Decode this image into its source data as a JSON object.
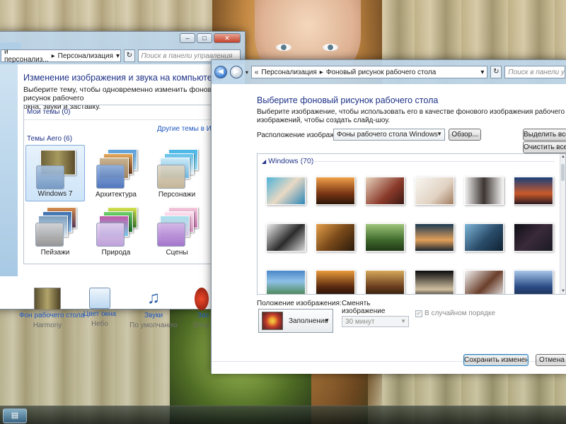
{
  "left_window": {
    "breadcrumb": [
      "и персонализ...",
      "Персонализация"
    ],
    "search_placeholder": "Поиск в панели управления",
    "title": "Изменение изображения и звука на компьютере",
    "desc_line1": "Выберите тему, чтобы одновременно изменить фоновый рисунок рабочего",
    "desc_line2": "окна, звуки и заставку.",
    "my_themes": "Мои темы (0)",
    "online_link": "Другие темы в Интер",
    "aero_themes": "Темы Aero (6)",
    "themes": [
      "Windows 7",
      "Архитектура",
      "Персонажи",
      "Пейзажи",
      "Природа",
      "Сцены"
    ],
    "bottom_items": [
      {
        "label": "Фон рабочего стола",
        "sub": "Harmony"
      },
      {
        "label": "Цвет окна",
        "sub": "Небо"
      },
      {
        "label": "Звуки",
        "sub": "По умолчанию"
      },
      {
        "label": "Зас",
        "sub": "Отсу"
      }
    ],
    "left_edge_text": "ск"
  },
  "right_window": {
    "breadcrumb": [
      "Персонализация",
      "Фоновый рисунок рабочего стола"
    ],
    "search_placeholder": "Поиск в панели управле",
    "title": "Выберите фоновый рисунок рабочего стола",
    "desc_line1": "Выберите изображение, чтобы использовать его в качестве фонового изображения рабочего стола, или выберите нескольк",
    "desc_line2": "изображений, чтобы создать слайд-шоу.",
    "location_label": "Расположение изображения:",
    "location_value": "Фоны рабочего стола Windows",
    "browse_button": "Обзор...",
    "select_all": "Выделить все",
    "clear_all": "Очистить все",
    "gallery_header": "Windows (70)",
    "position_label": "Положение изображения:",
    "position_value": "Заполнение",
    "change_label": "Сменять изображение каждые:",
    "interval_value": "30 минут",
    "shuffle_label": "В случайном порядке",
    "save_button": "Сохранить изменения",
    "cancel_button": "Отмена"
  },
  "colors": {
    "heading": "#1e3287",
    "link": "#1f57c3",
    "selection": "#cde4f8"
  }
}
